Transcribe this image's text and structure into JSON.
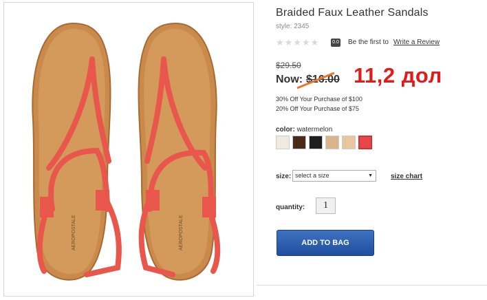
{
  "product": {
    "title": "Braided Faux Leather Sandals",
    "style_line": "style: 2345",
    "rating": {
      "value": "0.0",
      "star_count": 5,
      "prompt": "Be the first to",
      "link": "Write a Review"
    },
    "price": {
      "original": "$29.50",
      "now_label": "Now:",
      "now_price": "$16.00",
      "overlay_annotation": "11,2 дол",
      "overlay_color": "#e11a1a"
    },
    "promotions": [
      "30% Off Your Purchase of $100",
      "20% Off Your Purchase of $75"
    ],
    "color": {
      "label": "color:",
      "selected": "watermelon",
      "swatches": [
        {
          "name": "white",
          "color": "#efe9df"
        },
        {
          "name": "dark-brown",
          "color": "#4a2a1b"
        },
        {
          "name": "black",
          "color": "#1e1e1e"
        },
        {
          "name": "tan-multi",
          "color": "#d9b58c"
        },
        {
          "name": "natural",
          "color": "#e6c7a0"
        },
        {
          "name": "watermelon",
          "color": "#e8464a",
          "selected": true
        }
      ]
    },
    "size": {
      "label": "size:",
      "placeholder": "select a size",
      "chart_link": "size chart"
    },
    "quantity": {
      "label": "quantity:",
      "value": "1"
    },
    "add_to_bag": "ADD TO BAG",
    "brand_mark": "AEROPOSTALE"
  },
  "colors": {
    "accent": "#2b5fb0",
    "strap": "#e8564c",
    "footbed": "#c98a4c"
  }
}
